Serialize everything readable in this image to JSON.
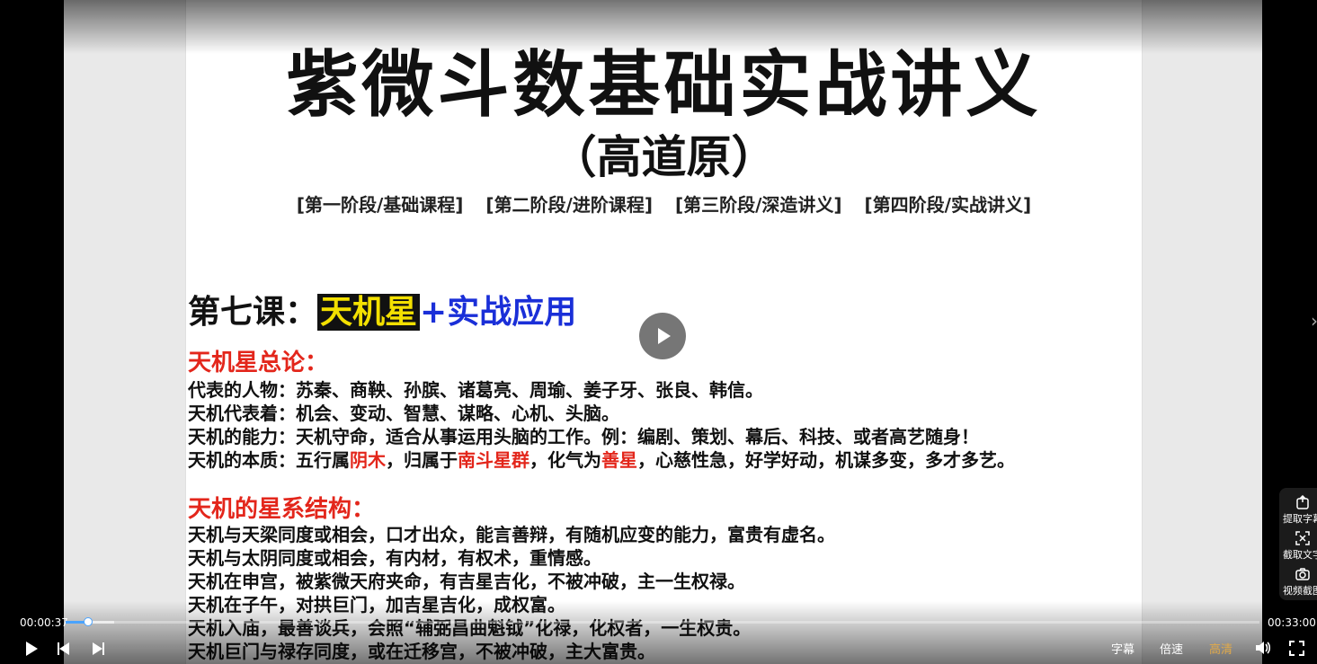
{
  "slide": {
    "title": "紫微斗数基础实战讲义",
    "subtitle": "（高道原）",
    "stages": [
      "[第一阶段/基础课程]",
      "[第二阶段/进阶课程]",
      "[第三阶段/深造讲义]",
      "[第四阶段/实战讲义]"
    ],
    "lesson": {
      "prefix": "第七课：",
      "highlight": "天机星",
      "suffix": "+实战应用"
    },
    "section1": {
      "title": "天机星总论：",
      "lines": [
        {
          "label": "代表的人物：",
          "text": "苏秦、商鞅、孙膑、诸葛亮、周瑜、姜子牙、张良、韩信。"
        },
        {
          "label": "天机代表着：",
          "text": "机会、变动、智慧、谋略、心机、头脑。"
        },
        {
          "label": "天机的能力：",
          "text": "天机守命，适合从事运用头脑的工作。例：编剧、策划、幕后、科技、或者高艺随身！"
        }
      ],
      "essence": {
        "a": "天机的本质：五行属",
        "b": "阴木",
        "c": "，归属于",
        "d": "南斗星群",
        "e": "，化气为",
        "f": "善星",
        "g": "，心慈性急，好学好动，机谋多变，多才多艺。"
      }
    },
    "section2": {
      "title": "天机的星系结构：",
      "lines": [
        "天机与天梁同度或相会，口才出众，能言善辩，有随机应变的能力，富贵有虚名。",
        "天机与太阴同度或相会，有内材，有权术，重情感。",
        "天机在申宫，被紫微天府夹命，有吉星吉化，不被冲破，主一生权禄。",
        "天机在子午，对拱巨门，加吉星吉化，成权富。",
        "天机入庙，最善谈兵，会照“辅弼昌曲魁钺”化禄，化权者，一生权贵。",
        "天机巨门与禄存同度，或在迁移宫，不被冲破，主大富贵。"
      ]
    }
  },
  "player": {
    "current_time": "00:00:37",
    "total_time": "00:33:00",
    "progress_fraction": 0.019,
    "buttons": {
      "subtitle": "字幕",
      "speed": "倍速",
      "quality": "高清"
    },
    "side_panel": [
      "提取字幕",
      "截取文字",
      "视频截图"
    ],
    "accent_color": "#4aa3ff",
    "quality_color": "#e0a94a"
  }
}
